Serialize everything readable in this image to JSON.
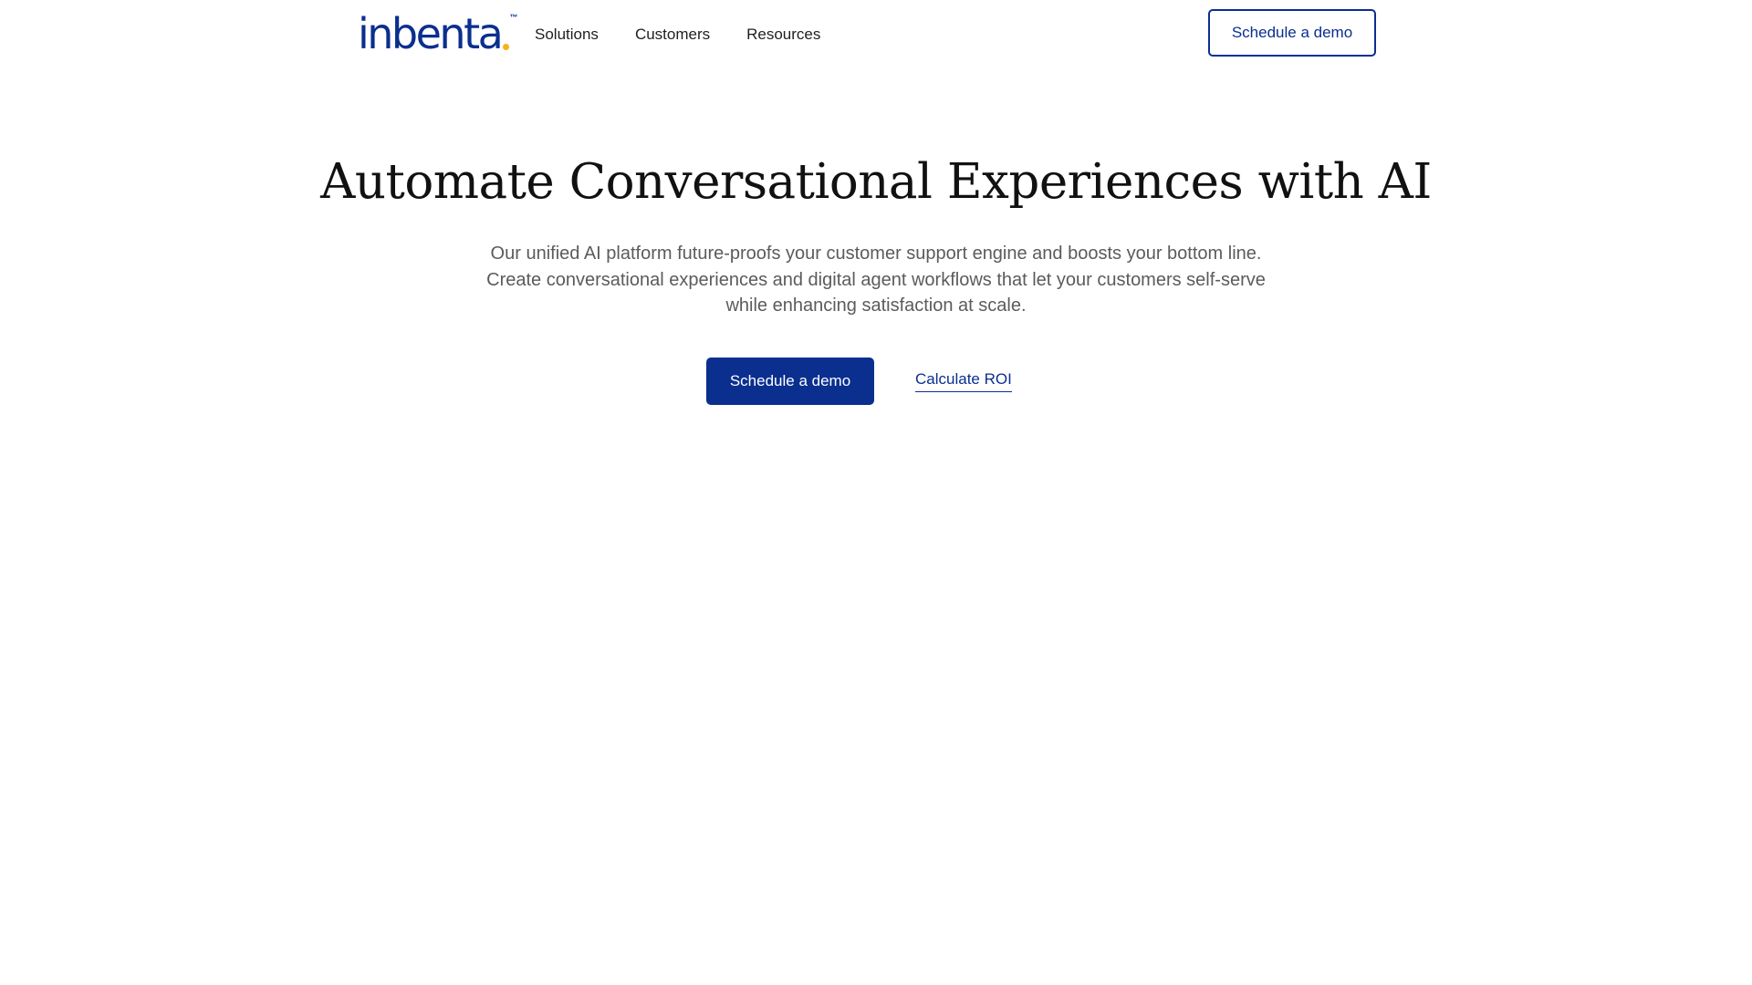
{
  "brand": {
    "name": "inbenta",
    "trademark": "™",
    "primary_color": "#0a2f8f",
    "accent_color": "#f2b418"
  },
  "nav": {
    "items": [
      {
        "label": "Solutions"
      },
      {
        "label": "Customers"
      },
      {
        "label": "Resources"
      }
    ],
    "cta_label": "Schedule a demo"
  },
  "hero": {
    "title": "Automate Conversational Experiences with AI",
    "subtitle_lines": [
      "Our unified AI platform future-proofs your customer support engine and boosts your bottom line.",
      "Create conversational experiences and digital agent workflows that let your customers self-serve",
      "while enhancing satisfaction at scale."
    ],
    "primary_cta_label": "Schedule a demo",
    "secondary_link_label": "Calculate ROI"
  }
}
